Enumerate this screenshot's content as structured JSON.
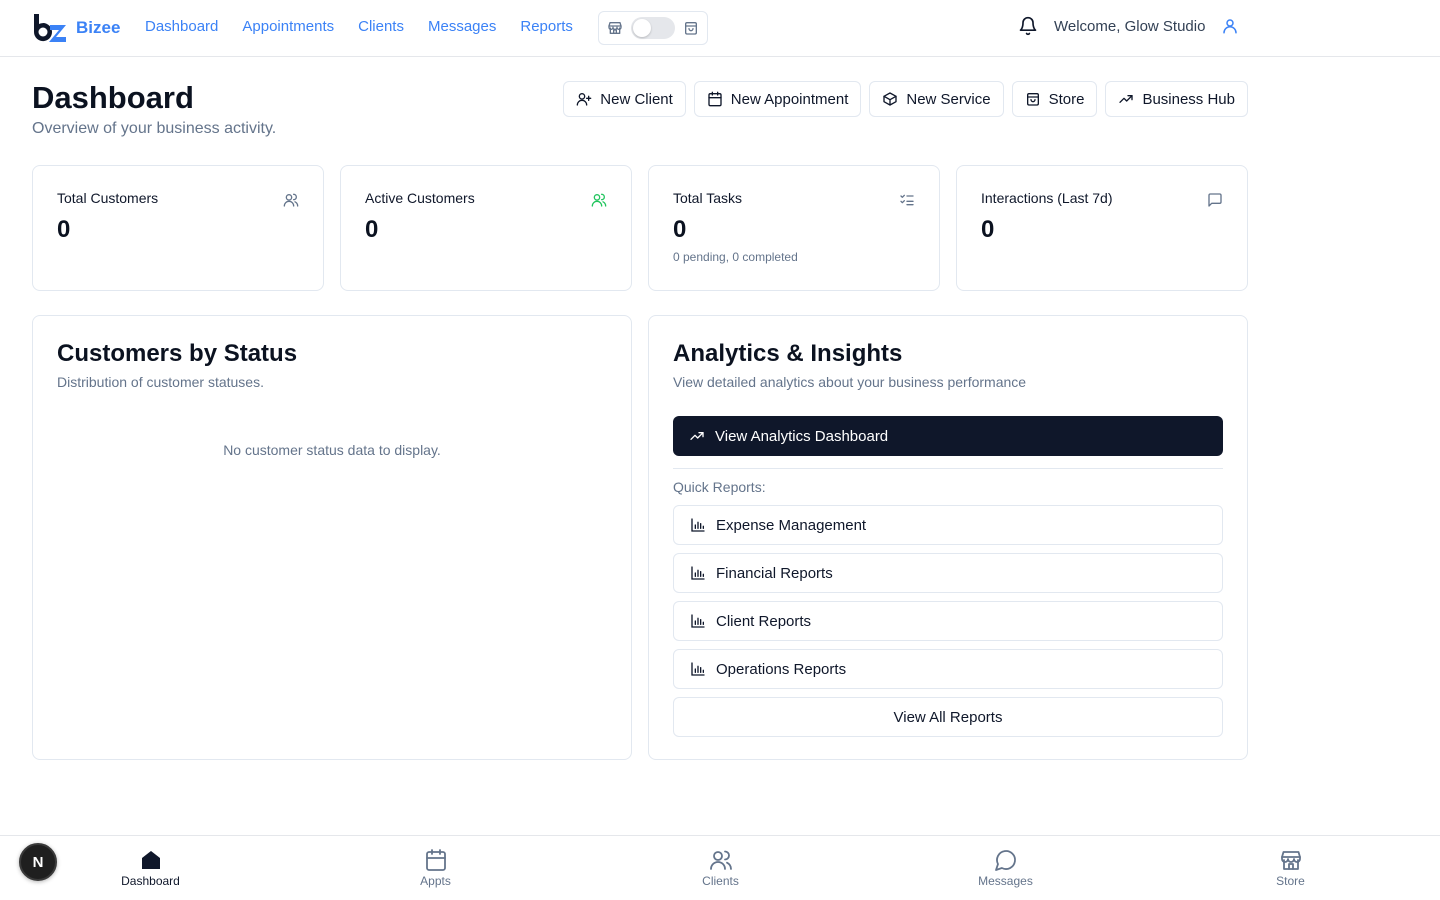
{
  "brand": {
    "name": "Bizee",
    "accent": "#3b82f6"
  },
  "nav": {
    "links": [
      "Dashboard",
      "Appointments",
      "Clients",
      "Messages",
      "Reports"
    ],
    "welcome": "Welcome, Glow Studio"
  },
  "header": {
    "title": "Dashboard",
    "subtitle": "Overview of your business activity.",
    "actions": [
      "New Client",
      "New Appointment",
      "New Service",
      "Store",
      "Business Hub"
    ]
  },
  "stats": [
    {
      "label": "Total Customers",
      "value": "0",
      "note": "",
      "icon": "users-icon"
    },
    {
      "label": "Active Customers",
      "value": "0",
      "note": "",
      "icon": "users-check-icon"
    },
    {
      "label": "Total Tasks",
      "value": "0",
      "note": "0 pending, 0 completed",
      "icon": "checklist-icon"
    },
    {
      "label": "Interactions (Last 7d)",
      "value": "0",
      "note": "",
      "icon": "message-icon"
    }
  ],
  "customers_panel": {
    "title": "Customers by Status",
    "subtitle": "Distribution of customer statuses.",
    "empty": "No customer status data to display."
  },
  "analytics_panel": {
    "title": "Analytics & Insights",
    "subtitle": "View detailed analytics about your business performance",
    "primary_button": "View Analytics Dashboard",
    "quick_label": "Quick Reports:",
    "reports": [
      "Expense Management",
      "Financial Reports",
      "Client Reports",
      "Operations Reports"
    ],
    "view_all": "View All Reports"
  },
  "bottom_nav": {
    "items": [
      "Dashboard",
      "Appts",
      "Clients",
      "Messages",
      "Store"
    ],
    "active": "Dashboard"
  },
  "dev_badge": "N"
}
